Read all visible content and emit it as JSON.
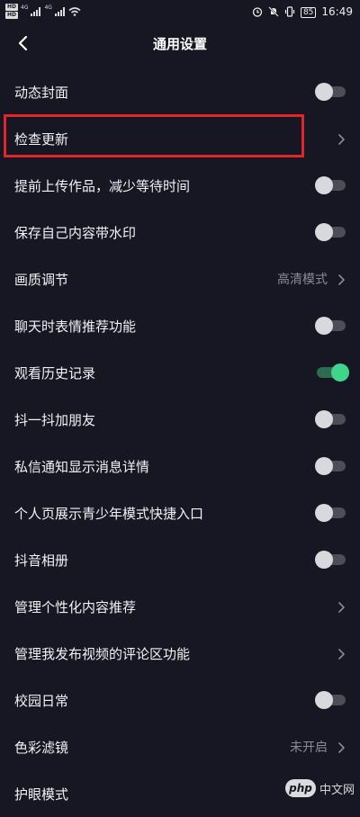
{
  "status_bar": {
    "sim1": "HD",
    "sim2": "HD",
    "network1": "4G",
    "network2": "4G",
    "battery": "85",
    "time": "16:49"
  },
  "header": {
    "title": "通用设置",
    "back_icon": "chevron-left-icon"
  },
  "settings": [
    {
      "label": "动态封面",
      "control": "toggle",
      "on": false
    },
    {
      "label": "检查更新",
      "control": "chevron",
      "highlighted": true
    },
    {
      "label": "提前上传作品，减少等待时间",
      "control": "toggle",
      "on": false
    },
    {
      "label": "保存自己内容带水印",
      "control": "toggle",
      "on": false
    },
    {
      "label": "画质调节",
      "control": "chevron",
      "value": "高清模式"
    },
    {
      "label": "聊天时表情推荐功能",
      "control": "toggle",
      "on": false
    },
    {
      "label": "观看历史记录",
      "control": "toggle",
      "on": true
    },
    {
      "label": "抖一抖加朋友",
      "control": "toggle",
      "on": false
    },
    {
      "label": "私信通知显示消息详情",
      "control": "toggle",
      "on": false
    },
    {
      "label": "个人页展示青少年模式快捷入口",
      "control": "toggle",
      "on": false
    },
    {
      "label": "抖音相册",
      "control": "toggle",
      "on": false
    },
    {
      "label": "管理个性化内容推荐",
      "control": "chevron"
    },
    {
      "label": "管理我发布视频的评论区功能",
      "control": "chevron"
    },
    {
      "label": "校园日常",
      "control": "toggle",
      "on": false
    },
    {
      "label": "色彩滤镜",
      "control": "chevron",
      "value": "未开启"
    },
    {
      "label": "护眼模式",
      "control": "none"
    }
  ],
  "colors": {
    "background": "#161722",
    "toggle_on": "#3fd68a",
    "highlight": "#e0262b"
  },
  "watermark": {
    "logo": "php",
    "text": "中文网"
  }
}
